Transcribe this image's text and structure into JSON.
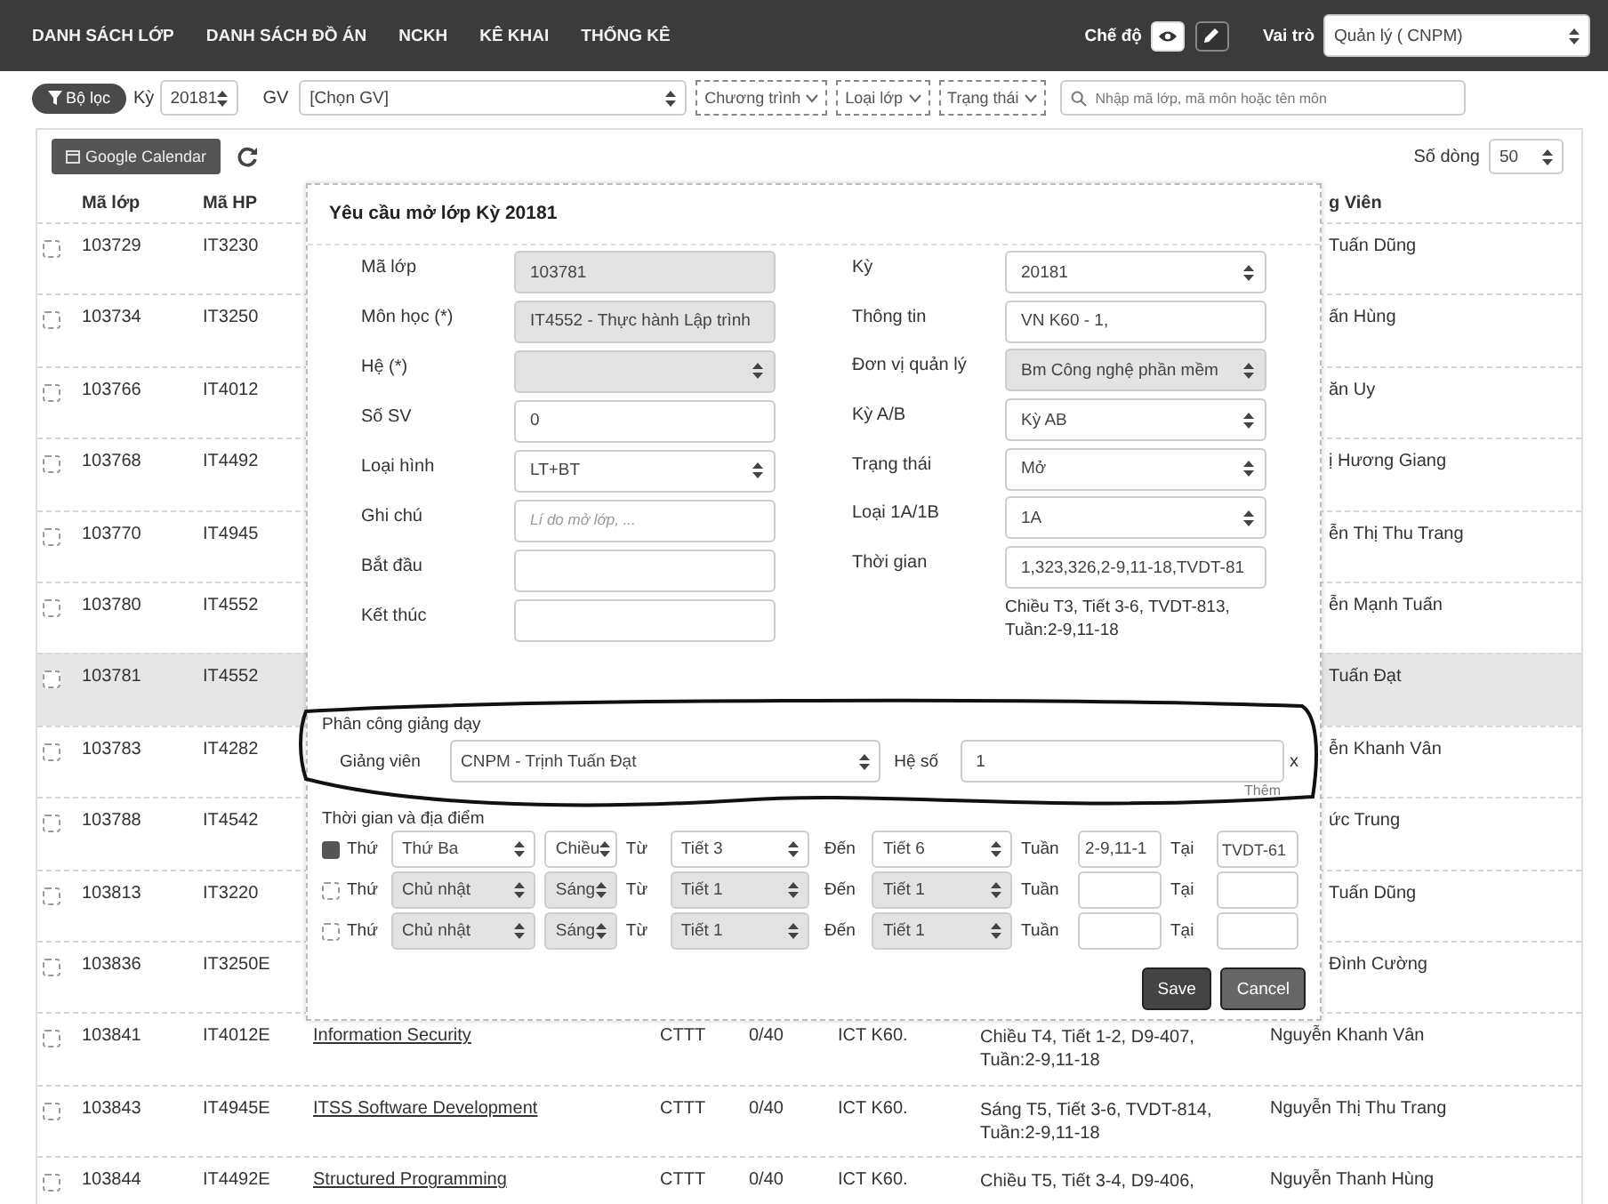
{
  "navbar": {
    "menu": [
      "DANH SÁCH LỚP",
      "DANH SÁCH ĐỒ ÁN",
      "NCKH",
      "KÊ KHAI",
      "THỐNG KÊ"
    ],
    "mode_label": "Chế độ",
    "role_label": "Vai trò",
    "role_value": "Quản lý ( CNPM)"
  },
  "filters": {
    "filter_button": "Bộ lọc",
    "term_label": "Kỳ",
    "term_value": "20181",
    "teacher_label": "GV",
    "teacher_value": "[Chọn GV]",
    "dropdowns": [
      "Chương trình",
      "Loại lớp",
      "Trạng thái"
    ],
    "search": {
      "placeholder": "Nhập mã lớp, mã môn hoặc tên môn"
    }
  },
  "toolbar": {
    "calendar_button": "Google Calendar",
    "rows_label": "Số dòng",
    "rows_value": "50"
  },
  "table": {
    "header": {
      "ma_lop": "Mã lớp",
      "ma_hp": "Mã HP",
      "column_9": "g Viên"
    },
    "rows": [
      {
        "kind": "covered",
        "selected": false,
        "checked": false,
        "ma_lop": "103729",
        "ma_hp": "IT3230",
        "teacher": "Tuấn Dũng"
      },
      {
        "kind": "covered",
        "selected": false,
        "checked": false,
        "ma_lop": "103734",
        "ma_hp": "IT3250",
        "teacher": "ấn Hùng"
      },
      {
        "kind": "covered",
        "selected": false,
        "checked": false,
        "ma_lop": "103766",
        "ma_hp": "IT4012",
        "teacher": "ăn Uy"
      },
      {
        "kind": "covered",
        "selected": false,
        "checked": false,
        "ma_lop": "103768",
        "ma_hp": "IT4492",
        "teacher": "ị Hương Giang"
      },
      {
        "kind": "covered",
        "selected": false,
        "checked": false,
        "ma_lop": "103770",
        "ma_hp": "IT4945",
        "teacher": "ễn Thị Thu Trang"
      },
      {
        "kind": "covered",
        "selected": false,
        "checked": false,
        "ma_lop": "103780",
        "ma_hp": "IT4552",
        "teacher": "ễn Mạnh Tuấn"
      },
      {
        "kind": "covered",
        "selected": true,
        "checked": false,
        "ma_lop": "103781",
        "ma_hp": "IT4552",
        "teacher": "Tuấn Đạt"
      },
      {
        "kind": "covered",
        "selected": false,
        "checked": false,
        "ma_lop": "103783",
        "ma_hp": "IT4282",
        "teacher": "ễn Khanh Vân"
      },
      {
        "kind": "covered",
        "selected": false,
        "checked": false,
        "ma_lop": "103788",
        "ma_hp": "IT4542",
        "teacher": "ức Trung"
      },
      {
        "kind": "covered",
        "selected": false,
        "checked": false,
        "ma_lop": "103813",
        "ma_hp": "IT3220",
        "teacher": "Tuấn Dũng"
      },
      {
        "kind": "covered",
        "selected": false,
        "checked": false,
        "ma_lop": "103836",
        "ma_hp": "IT3250E",
        "teacher": "Đình Cường"
      },
      {
        "kind": "full",
        "selected": false,
        "checked": false,
        "ma_lop": "103841",
        "ma_hp": "IT4012E",
        "course": "Information Security",
        "program": "CTTT",
        "enrolled": "0/40",
        "group": "ICT K60.",
        "schedule": [
          "Chiều T4, Tiết 1-2, D9-407,",
          "Tuần:2-9,11-18"
        ],
        "teacher": "Nguyễn Khanh Vân"
      },
      {
        "kind": "full",
        "selected": false,
        "checked": false,
        "ma_lop": "103843",
        "ma_hp": "IT4945E",
        "course": "ITSS Software Development",
        "program": "CTTT",
        "enrolled": "0/40",
        "group": "ICT K60.",
        "schedule": [
          "Sáng T5, Tiết 3-6, TVDT-814,",
          "Tuần:2-9,11-18"
        ],
        "teacher": "Nguyễn Thị Thu Trang"
      },
      {
        "kind": "full",
        "selected": false,
        "checked": false,
        "ma_lop": "103844",
        "ma_hp": "IT4492E",
        "course": "Structured Programming",
        "program": "CTTT",
        "enrolled": "0/40",
        "group": "ICT K60.",
        "schedule": [
          "Chiều T5, Tiết 3-4, D9-406,"
        ],
        "teacher": "Nguyễn Thanh Hùng"
      }
    ]
  },
  "modal": {
    "title": "Yêu cầu mở lớp Kỳ 20181",
    "left_fields": [
      {
        "label": "Mã lớp",
        "kind": "input",
        "disabled": true,
        "value": "103781"
      },
      {
        "label": "Môn học (*)",
        "kind": "input",
        "disabled": true,
        "value": "IT4552 - Thực hành Lập trình"
      },
      {
        "label": "Hệ (*)",
        "kind": "select",
        "disabled": true
      },
      {
        "label": "Số SV",
        "kind": "input",
        "disabled": false,
        "value": "0"
      },
      {
        "label": "Loại hình",
        "kind": "select",
        "disabled": false,
        "value": "LT+BT"
      },
      {
        "label": "Ghi chú",
        "kind": "input",
        "disabled": false,
        "placeholder": "Lí do mở lớp, ..."
      },
      {
        "label": "Bắt đầu",
        "kind": "input",
        "disabled": false
      },
      {
        "label": "Kết thúc",
        "kind": "input",
        "disabled": false
      }
    ],
    "right_fields": [
      {
        "label": "Kỳ",
        "kind": "select",
        "disabled": false,
        "value": "20181"
      },
      {
        "label": "Thông tin",
        "kind": "input",
        "disabled": false,
        "value": "VN K60 - 1,"
      },
      {
        "label": "Đơn vị quản lý",
        "kind": "select",
        "disabled": true,
        "value": "Bm Công nghệ phần mềm"
      },
      {
        "label": "Kỳ A/B",
        "kind": "select",
        "disabled": false,
        "value": "Kỳ AB"
      },
      {
        "label": "Trạng thái",
        "kind": "select",
        "disabled": false,
        "value": "Mở"
      },
      {
        "label": "Loại 1A/1B",
        "kind": "select",
        "disabled": false,
        "value": "1A"
      },
      {
        "label": "Thời gian",
        "kind": "input",
        "disabled": false,
        "value": "1,323,326,2-9,11-18,TVDT-81",
        "note": [
          "Chiều T3, Tiết 3-6, TVDT-813,",
          "Tuần:2-9,11-18"
        ]
      }
    ],
    "assignment": {
      "title": "Phân công giảng dạy",
      "teacher_label": "Giảng viên",
      "teacher_value": "CNPM - Trịnh Tuấn Đạt",
      "factor_label": "Hệ số",
      "factor_value": "1",
      "remove": "x",
      "add_link": "Thêm"
    },
    "schedule": {
      "title": "Thời gian và địa điểm",
      "rows": [
        {
          "checked": true,
          "day_label": "Thứ",
          "day": "Thứ Ba",
          "session": "Chiều",
          "from_label": "Từ",
          "from": "Tiết 3",
          "to_label": "Đến",
          "to": "Tiết 6",
          "week_label": "Tuần",
          "weeks": "2-9,11-1",
          "place_label": "Tại",
          "place": "TVDT-61"
        },
        {
          "checked": false,
          "day_label": "Thứ",
          "day": "Chủ nhật",
          "session": "Sáng",
          "from_label": "Từ",
          "from": "Tiết 1",
          "to_label": "Đến",
          "to": "Tiết 1",
          "week_label": "Tuần",
          "place_label": "Tại"
        },
        {
          "checked": false,
          "day_label": "Thứ",
          "day": "Chủ nhật",
          "session": "Sáng",
          "from_label": "Từ",
          "from": "Tiết 1",
          "to_label": "Đến",
          "to": "Tiết 1",
          "week_label": "Tuần",
          "place_label": "Tại"
        }
      ]
    },
    "buttons": [
      {
        "label": "Save",
        "kind": "primary"
      },
      {
        "label": "Cancel",
        "kind": "default"
      }
    ]
  }
}
